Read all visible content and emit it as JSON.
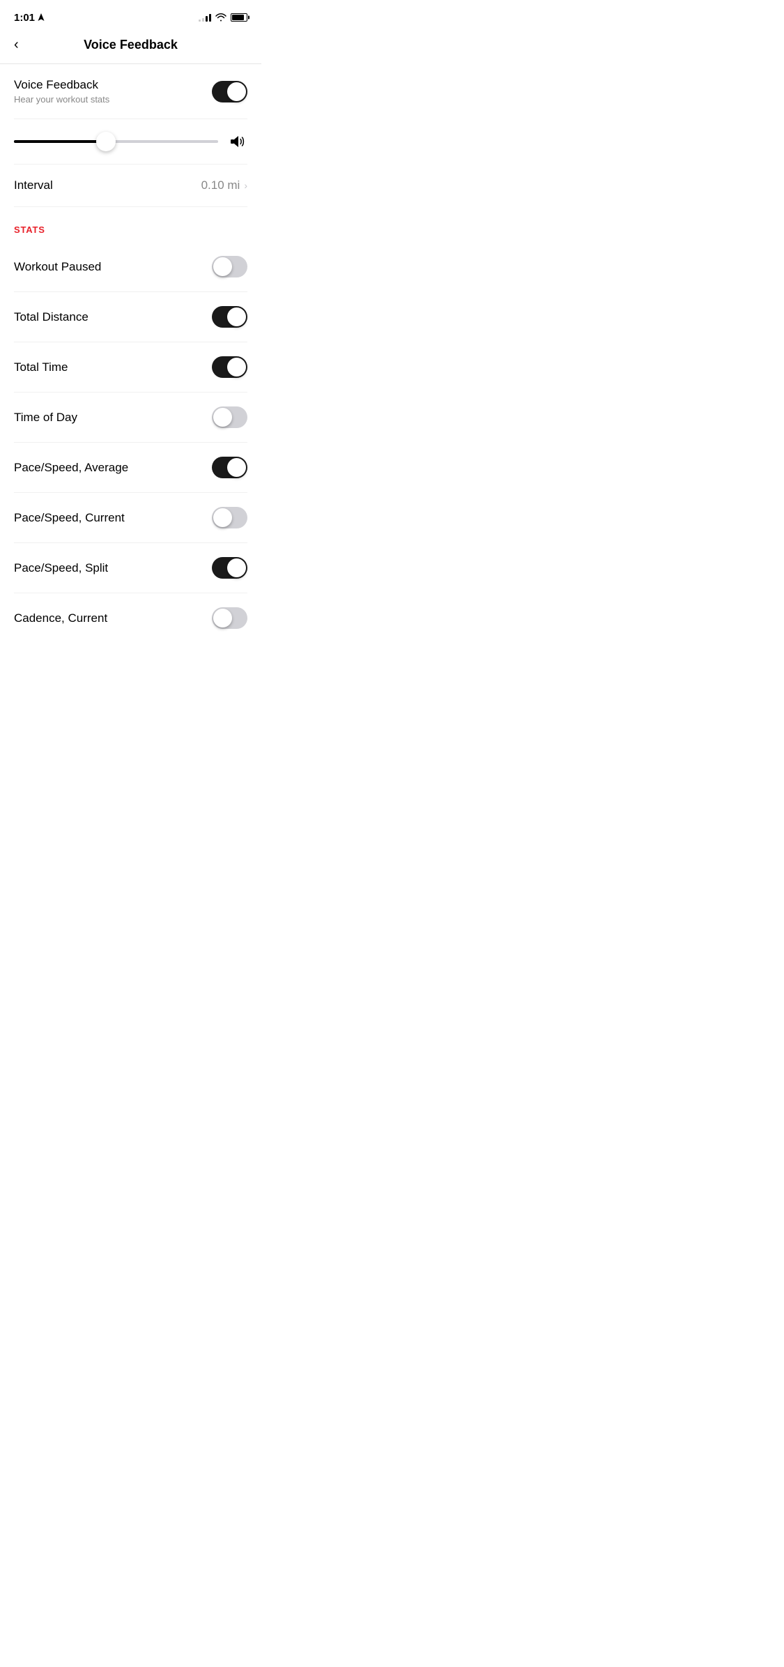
{
  "statusBar": {
    "time": "1:01",
    "hasLocation": true
  },
  "header": {
    "backLabel": "‹",
    "title": "Voice Feedback"
  },
  "voiceFeedback": {
    "label": "Voice Feedback",
    "sublabel": "Hear your workout stats",
    "enabled": true
  },
  "volume": {
    "value": 45
  },
  "interval": {
    "label": "Interval",
    "value": "0.10 mi"
  },
  "sections": [
    {
      "title": "STATS",
      "items": [
        {
          "label": "Workout Paused",
          "enabled": false
        },
        {
          "label": "Total Distance",
          "enabled": true
        },
        {
          "label": "Total Time",
          "enabled": true
        },
        {
          "label": "Time of Day",
          "enabled": false
        },
        {
          "label": "Pace/Speed, Average",
          "enabled": true
        },
        {
          "label": "Pace/Speed, Current",
          "enabled": false
        },
        {
          "label": "Pace/Speed, Split",
          "enabled": true
        },
        {
          "label": "Cadence, Current",
          "enabled": false
        }
      ]
    }
  ]
}
